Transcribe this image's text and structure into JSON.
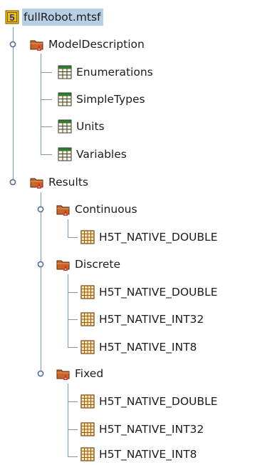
{
  "tree": {
    "root": {
      "label": "fullRobot.mtsf",
      "icon": "hdf5-file-icon"
    },
    "groups": [
      {
        "label": "ModelDescription",
        "icon": "folder-group-icon",
        "children": [
          {
            "label": "Enumerations",
            "icon": "table-dataset-icon"
          },
          {
            "label": "SimpleTypes",
            "icon": "table-dataset-icon"
          },
          {
            "label": "Units",
            "icon": "table-dataset-icon"
          },
          {
            "label": "Variables",
            "icon": "table-dataset-icon"
          }
        ]
      },
      {
        "label": "Results",
        "icon": "folder-group-icon",
        "subgroups": [
          {
            "label": "Continuous",
            "icon": "folder-group-icon",
            "children": [
              {
                "label": "H5T_NATIVE_DOUBLE",
                "icon": "dataset-grid-icon"
              }
            ]
          },
          {
            "label": "Discrete",
            "icon": "folder-group-icon",
            "children": [
              {
                "label": "H5T_NATIVE_DOUBLE",
                "icon": "dataset-grid-icon"
              },
              {
                "label": "H5T_NATIVE_INT32",
                "icon": "dataset-grid-icon"
              },
              {
                "label": "H5T_NATIVE_INT8",
                "icon": "dataset-grid-icon"
              }
            ]
          },
          {
            "label": "Fixed",
            "icon": "folder-group-icon",
            "children": [
              {
                "label": "H5T_NATIVE_DOUBLE",
                "icon": "dataset-grid-icon"
              },
              {
                "label": "H5T_NATIVE_INT32",
                "icon": "dataset-grid-icon"
              },
              {
                "label": "H5T_NATIVE_INT8",
                "icon": "dataset-grid-icon"
              }
            ]
          }
        ]
      }
    ]
  },
  "colors": {
    "selection": "#b8cfe5",
    "tree_line": "#7d98b3",
    "folder": "#b5521e",
    "folder_badge": "#e0241b",
    "table_header": "#2f7d2f",
    "dataset_grid": "#a05a10"
  }
}
